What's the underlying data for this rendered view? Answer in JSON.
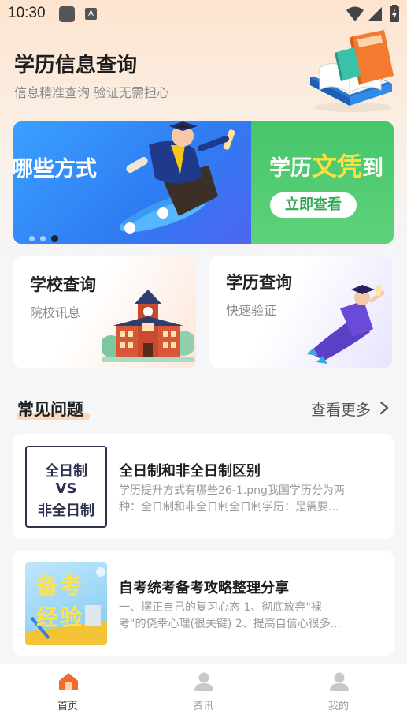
{
  "status_bar": {
    "time": "10:30"
  },
  "header": {
    "title": "学历信息查询",
    "subtitle": "信息精准查询 验证无需担心"
  },
  "banner": {
    "left_text": "哪些方式",
    "right_text_a": "学历",
    "right_text_b": "文凭",
    "right_text_c": "到",
    "button_label": "立即查看",
    "page_count": 3,
    "active_page": 3
  },
  "cards": [
    {
      "title": "学校查询",
      "subtitle": "院校讯息"
    },
    {
      "title": "学历查询",
      "subtitle": "快速验证"
    }
  ],
  "faq_section": {
    "title": "常见问题",
    "more_label": "查看更多"
  },
  "articles": [
    {
      "thumb_lines": [
        "全日制",
        "VS",
        "非全日制"
      ],
      "title": "全日制和非全日制区别",
      "desc_line1": "学历提升方式有哪些26-1.png我国学历分为两",
      "desc_line2": "种：全日制和非全日制全日制学历：是需要..."
    },
    {
      "thumb_lines": [
        "备考",
        "经验"
      ],
      "title": "自考统考备考攻略整理分享",
      "desc_line1": "一、摆正自己的复习心态 1、彻底放弃\"裸",
      "desc_line2": "考\"的侥幸心理(很关键) 2、提高自信心很多..."
    }
  ],
  "bottom_nav": {
    "items": [
      {
        "label": "首页",
        "icon": "home-icon",
        "active": true
      },
      {
        "label": "资讯",
        "icon": "person-icon",
        "active": false
      },
      {
        "label": "我的",
        "icon": "profile-icon",
        "active": false
      }
    ]
  },
  "colors": {
    "accent_orange": "#f36b2a",
    "banner_blue": "#2f7bf2",
    "banner_green": "#4cc872",
    "highlight_yellow": "#ffe03a"
  }
}
